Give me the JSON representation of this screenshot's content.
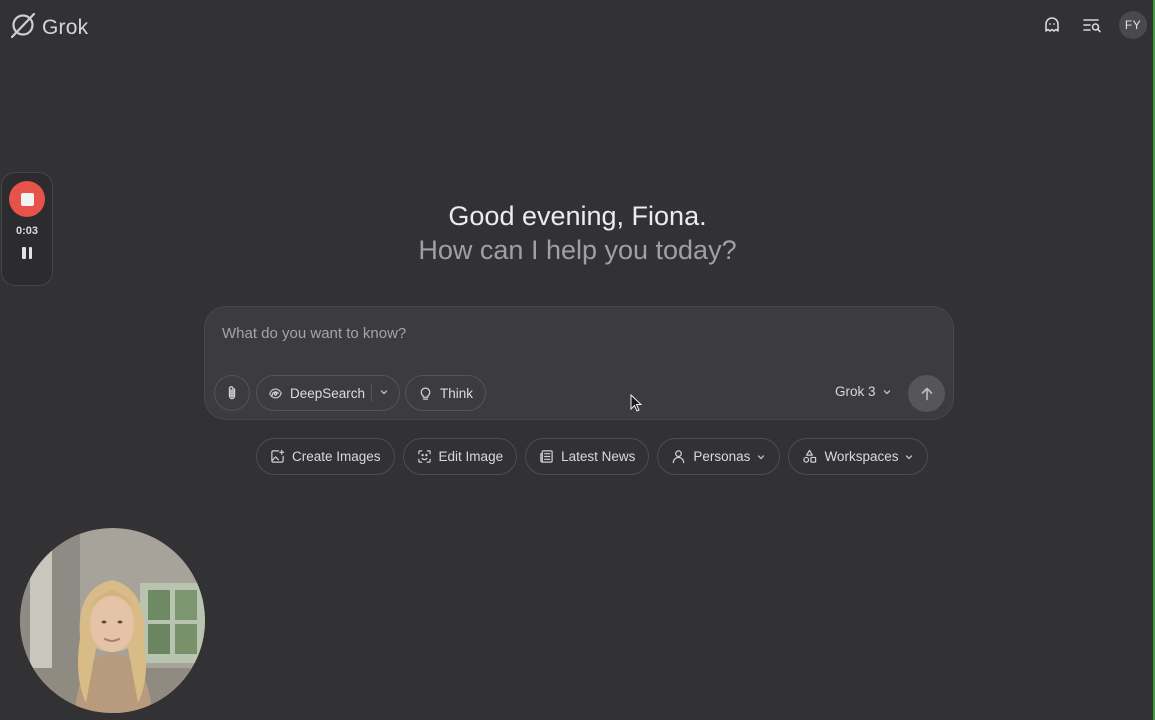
{
  "app": {
    "logo_text": "Grok",
    "user_initials": "FY"
  },
  "header_icons": [
    "ghost-icon",
    "chat-history-search-icon"
  ],
  "recording": {
    "time": "0:03"
  },
  "greeting": {
    "line1": "Good evening, Fiona.",
    "line2": "How can I help you today?"
  },
  "composer": {
    "placeholder": "What do you want to know?",
    "deepsearch_label": "DeepSearch",
    "think_label": "Think",
    "model_label": "Grok 3"
  },
  "quick_actions": {
    "create_images": "Create Images",
    "edit_image": "Edit Image",
    "latest_news": "Latest News",
    "personas": "Personas",
    "workspaces": "Workspaces"
  },
  "colors": {
    "background": "#323235",
    "composer_bg": "#3c3c40",
    "record_red": "#e5534b"
  }
}
